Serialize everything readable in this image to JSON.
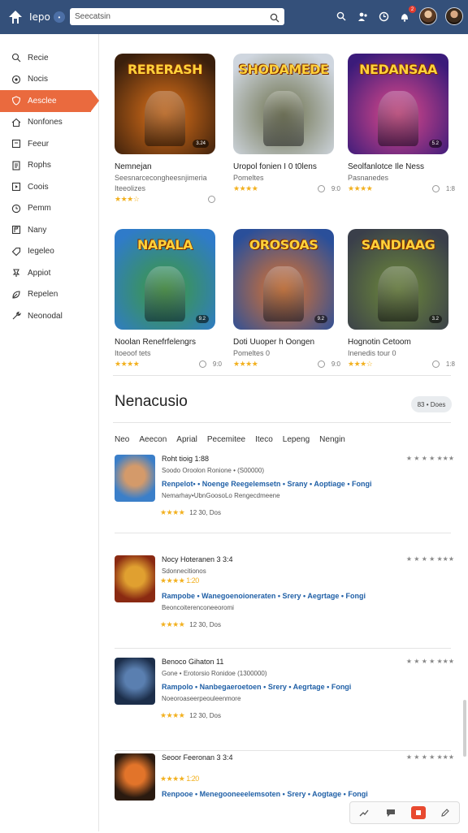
{
  "topbar": {
    "logo_text": "Iepo",
    "brand_badge": "•",
    "search_placeholder": "Seecatsin",
    "notif_count": "2"
  },
  "sidebar": {
    "items": [
      {
        "label": "Recie",
        "icon": "search-icon"
      },
      {
        "label": "Nocis",
        "icon": "gear-icon"
      },
      {
        "label": "Aesclee",
        "icon": "shield-icon",
        "active": true
      },
      {
        "label": "Nonfones",
        "icon": "home-icon"
      },
      {
        "label": "Feeur",
        "icon": "box-icon"
      },
      {
        "label": "Rophs",
        "icon": "doc-icon"
      },
      {
        "label": "Coois",
        "icon": "play-icon"
      },
      {
        "label": "Pemm",
        "icon": "clock-icon"
      },
      {
        "label": "Nany",
        "icon": "flag-icon"
      },
      {
        "label": "Iegeleo",
        "icon": "tag-icon"
      },
      {
        "label": "Appiot",
        "icon": "pin-icon"
      },
      {
        "label": "Repelen",
        "icon": "leaf-icon"
      },
      {
        "label": "Neonodal",
        "icon": "wrench-icon"
      }
    ]
  },
  "cards": [
    {
      "art": "RERERASH",
      "badge": "3.24",
      "title": "Nemnejan",
      "sub": "Seesnarcecongheesnjimeria",
      "sub2": "Iteeolizes",
      "stars": "★★★☆",
      "count": "",
      "colors": [
        "#3a1f0c",
        "#e2741a"
      ]
    },
    {
      "art": "SHODAMEDE",
      "badge": "",
      "title": "Uropol fonien I 0 t0lens",
      "sub": "Pomeltes",
      "sub2": "",
      "stars": "★★★★",
      "count": "9:0",
      "colors": [
        "#cfd6df",
        "#6b6f4a"
      ]
    },
    {
      "art": "NEDANSAA",
      "badge": "5.2",
      "title": "Seolfanlotce Ile Ness",
      "sub": "Pasnanedes",
      "sub2": "",
      "stars": "★★★★",
      "count": "1:8",
      "colors": [
        "#3b1b7a",
        "#e04a8a"
      ]
    },
    {
      "art": "NAPALA",
      "badge": "9.2",
      "title": "Noolan Renefrfelengrs",
      "sub": "Itoeoof tets",
      "sub2": "",
      "stars": "★★★★",
      "count": "9:0",
      "colors": [
        "#2f7bc9",
        "#3e9a3a"
      ]
    },
    {
      "art": "OROSOAS",
      "badge": "9.2",
      "title": "Doti Uuoper h Oongen",
      "sub": "Pomeltes 0",
      "sub2": "",
      "stars": "★★★★",
      "count": "9:0",
      "colors": [
        "#2a4f9a",
        "#e2742a"
      ]
    },
    {
      "art": "SANDIAAG",
      "badge": "3.2",
      "title": "Hognotin Cetoom",
      "sub": "Inenedis tour 0",
      "sub2": "",
      "stars": "★★★☆",
      "count": "1:8",
      "colors": [
        "#3a3f4a",
        "#6e8a3a"
      ]
    }
  ],
  "section": {
    "title": "Nenacusio",
    "pill": "83 • Does",
    "filters": [
      "Neo",
      "Aeecon",
      "Aprial",
      "Pecemitee",
      "Iteco",
      "Lepeng",
      "Nengin"
    ]
  },
  "rows": [
    {
      "title": "Roht  tioig  1:88",
      "line2": "Soodo  Oroolon  Ronione • (S00000)",
      "links": "Renpelot• • Noenge Reegelemsetn •  Srany • Aoptiage •  Fongi",
      "desc": "Nemarhay•UbnGoosoLo Rengecdmeene",
      "rating": "★★★★",
      "meta": "12 30, Dos",
      "right": "★ ★ ★ ★ ★★★",
      "line2b": "",
      "rating_top": ""
    },
    {
      "title": "Nocy  Hoteranen  3  3:4",
      "line2": "Sdonnecitionos",
      "links": "Rampobe • Wanegoenoioneraten  • Srery • Aegrtage •  Fongi",
      "desc": "Beoncoiterenconeeoromi",
      "rating": "★★★★",
      "meta": "12 30, Dos",
      "right": "★ ★ ★ ★ ★★★",
      "rating_top": "★★★★   1:20"
    },
    {
      "title": "Benoco  Gihaton  11",
      "line2": "Gone • Erotorsio Ronidoe  (1300000)",
      "links": "Rampolo • Nanbegaeroetoen  •  Srery • Aegrtage •  Fongi",
      "desc": "Noeoroaseerpeouleenmore",
      "rating": "★★★★",
      "meta": "12 30, Dos",
      "right": "★ ★ ★ ★ ★★★",
      "rating_top": ""
    },
    {
      "title": "Seoor  Feeronan  3  3:4",
      "line2": "",
      "links": "Renpooe • Menegooneeelemsoten  •  Srery •  Aogtage • Fongi",
      "desc": "",
      "rating": "",
      "meta": "",
      "right": "★ ★ ★ ★ ★★★",
      "rating_top": "★★★★   1:20"
    }
  ]
}
